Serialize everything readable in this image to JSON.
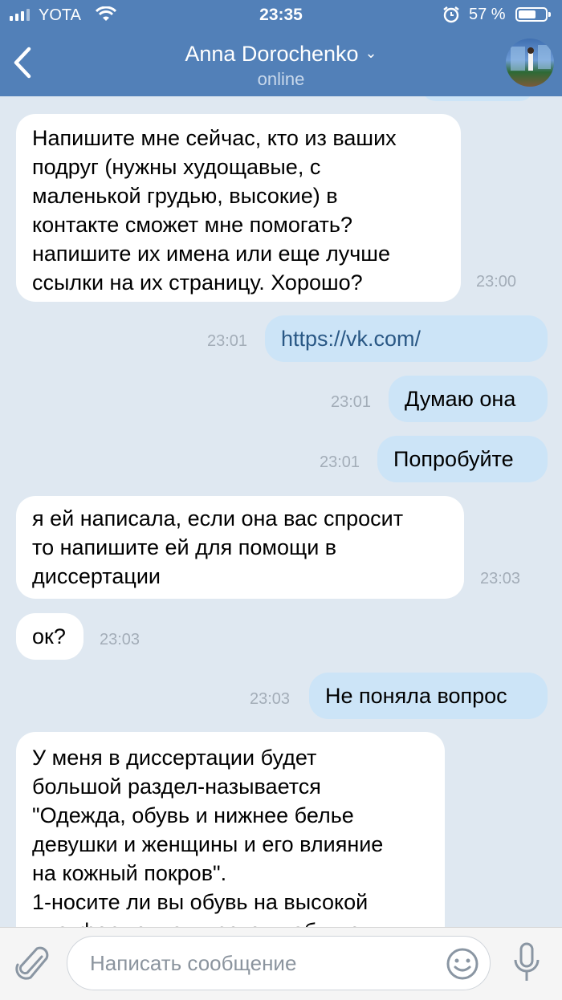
{
  "status_bar": {
    "carrier": "YOTA",
    "time": "23:35",
    "battery": "57 %",
    "battery_level": 0.57
  },
  "header": {
    "name": "Anna Dorochenko",
    "status": "online"
  },
  "messages": [
    {
      "dir": "in",
      "text": "Напишите мне сейчас, кто из ваших\nподруг (нужны худощавые, с\nмаленькой грудью, высокие) в\nконтакте сможет мне помогать?\nнапишите их имена или еще лучше\nссылки на их страницу. Хорошо?",
      "time": "23:00"
    },
    {
      "dir": "out",
      "text": "https://vk.com/",
      "time": "23:01"
    },
    {
      "dir": "out",
      "text": "Думаю она",
      "time": "23:01"
    },
    {
      "dir": "out",
      "text": "Попробуйте",
      "time": "23:01"
    },
    {
      "dir": "in",
      "text": "я ей написала, если она вас спросит\nто напишите ей для помощи в\nдиссертации",
      "time": "23:03"
    },
    {
      "dir": "in",
      "text": "ок?",
      "time": "23:03"
    },
    {
      "dir": "out",
      "text": "Не поняла вопрос",
      "time": "23:03"
    },
    {
      "dir": "in",
      "text": "У меня в диссертации будет\nбольшой раздел-называется\n\"Одежда, обувь и нижнее белье\nдевушки и женщины и его влияние\nна кожный покров\".\n1-носите ли вы обувь на высокой\nплатформе, на высоком каблуке",
      "time": ""
    }
  ],
  "composer": {
    "placeholder": "Написать сообщение"
  },
  "colors": {
    "header": "#5280b8",
    "incoming": "#ffffff",
    "outgoing": "#cce4f7",
    "background": "#dfe8f1"
  },
  "icons": [
    "back-chevron-icon",
    "paperclip-icon",
    "emoji-icon",
    "microphone-icon",
    "wifi-icon",
    "alarm-icon"
  ]
}
